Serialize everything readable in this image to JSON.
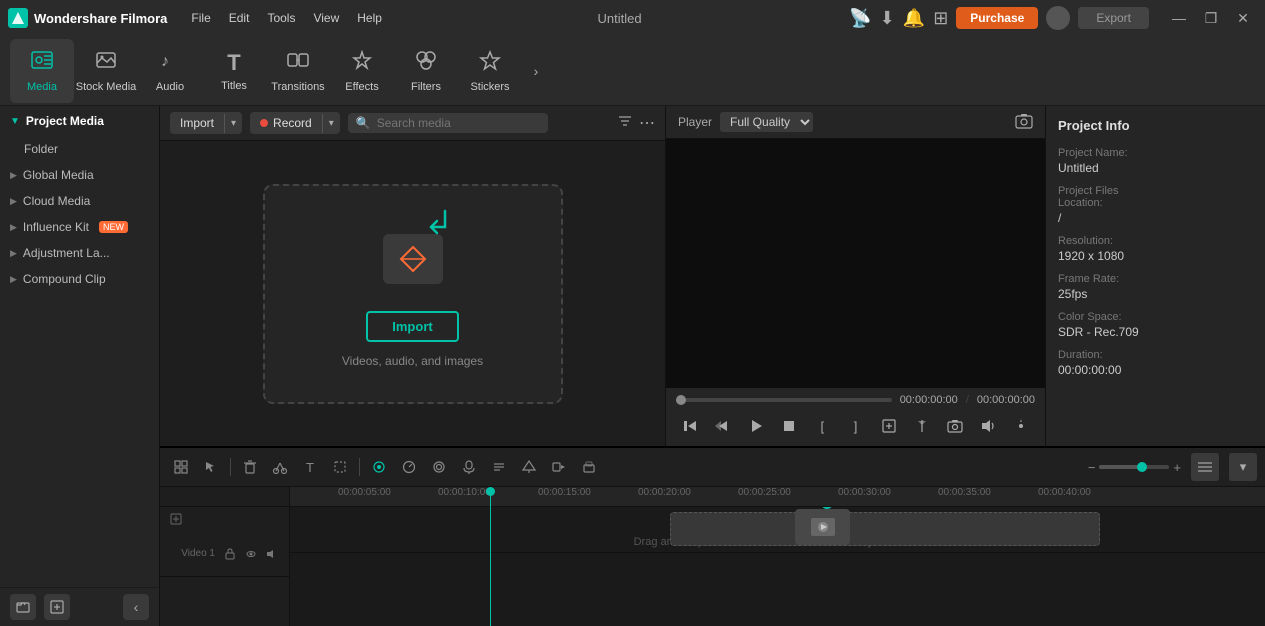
{
  "app": {
    "name": "Wondershare Filmora",
    "title": "Untitled"
  },
  "title_bar": {
    "logo_letter": "F",
    "menus": [
      "File",
      "Edit",
      "Tools",
      "View",
      "Help"
    ],
    "purchase_label": "Purchase",
    "export_label": "Export",
    "window_controls": [
      "—",
      "❐",
      "✕"
    ]
  },
  "toolbar": {
    "items": [
      {
        "id": "media",
        "icon": "🎬",
        "label": "Media",
        "active": true
      },
      {
        "id": "stock",
        "icon": "🗃",
        "label": "Stock Media",
        "active": false
      },
      {
        "id": "audio",
        "icon": "🎵",
        "label": "Audio",
        "active": false
      },
      {
        "id": "titles",
        "icon": "T",
        "label": "Titles",
        "active": false
      },
      {
        "id": "transitions",
        "icon": "⧉",
        "label": "Transitions",
        "active": false
      },
      {
        "id": "effects",
        "icon": "✨",
        "label": "Effects",
        "active": false
      },
      {
        "id": "filters",
        "icon": "🎨",
        "label": "Filters",
        "active": false
      },
      {
        "id": "stickers",
        "icon": "⭐",
        "label": "Stickers",
        "active": false
      }
    ],
    "more_icon": "›"
  },
  "left_sidebar": {
    "header": "Project Media",
    "folder_label": "Folder",
    "sections": [
      {
        "label": "Global Media"
      },
      {
        "label": "Cloud Media"
      },
      {
        "label": "Influence Kit",
        "badge": "NEW"
      },
      {
        "label": "Adjustment La..."
      },
      {
        "label": "Compound Clip"
      }
    ],
    "add_icon": "+",
    "folder_icon": "📁",
    "collapse_icon": "‹"
  },
  "media_toolbar": {
    "import_label": "Import",
    "record_label": "Record",
    "search_placeholder": "Search media",
    "filter_icon": "filter",
    "more_icon": "⋯"
  },
  "import_area": {
    "import_btn_label": "Import",
    "subtitle": "Videos, audio, and images"
  },
  "player": {
    "label": "Player",
    "quality": "Full Quality",
    "snapshot_icon": "📷",
    "time_current": "00:00:00:00",
    "time_total": "00:00:00:00",
    "controls": {
      "skip_back": "⏮",
      "step_back": "⏪",
      "play": "▶",
      "stop": "⏹",
      "mark_in": "[",
      "mark_out": "]",
      "split": "✂",
      "snapshot": "📷",
      "audio": "🔊",
      "settings": "⚙"
    }
  },
  "project_info": {
    "title": "Project Info",
    "fields": [
      {
        "label": "Project Name:",
        "value": "Untitled"
      },
      {
        "label": "Project Files\nLocation:",
        "value": "/"
      },
      {
        "label": "Resolution:",
        "value": "1920 x 1080"
      },
      {
        "label": "Frame Rate:",
        "value": "25fps"
      },
      {
        "label": "Color Space:",
        "value": "SDR - Rec.709"
      },
      {
        "label": "Duration:",
        "value": "00:00:00:00"
      }
    ]
  },
  "timeline": {
    "tools": [
      {
        "icon": "⊞",
        "label": "scene-detect",
        "active": false
      },
      {
        "icon": "↗",
        "label": "select",
        "active": false
      },
      {
        "icon": "🗑",
        "label": "delete",
        "active": false
      },
      {
        "icon": "✂",
        "label": "cut",
        "active": false
      },
      {
        "icon": "T",
        "label": "text",
        "active": false
      },
      {
        "icon": "⬜",
        "label": "crop",
        "active": false
      },
      {
        "icon": "⟳",
        "label": "loop",
        "label2": "highlighted",
        "active": true
      },
      {
        "icon": "⊙",
        "label": "speed",
        "active": false
      },
      {
        "icon": "◎",
        "label": "mask",
        "active": false
      },
      {
        "icon": "🎙",
        "label": "record",
        "active": false
      },
      {
        "icon": "≣",
        "label": "tts",
        "active": false
      },
      {
        "icon": "⊕",
        "label": "add-marker",
        "active": false
      },
      {
        "icon": "⊞",
        "label": "multicam",
        "active": false
      },
      {
        "icon": "⊡",
        "label": "composite",
        "active": false
      }
    ],
    "zoom": {
      "min_icon": "−",
      "max_icon": "+"
    },
    "ruler_marks": [
      "00:00:05:00",
      "00:00:10:00",
      "00:00:15:00",
      "00:00:20:00",
      "00:00:25:00",
      "00:00:30:00",
      "00:00:35:00",
      "00:00:40:00"
    ],
    "track_label": "Video 1",
    "drag_hint": "Drag and drop media and effects here to create your video."
  },
  "colors": {
    "accent": "#00c2a8",
    "purchase": "#e05c1a",
    "bg_dark": "#1a1a1a",
    "bg_mid": "#252525",
    "bg_light": "#2b2b2b",
    "border": "#111111",
    "text_primary": "#ffffff",
    "text_secondary": "#cccccc",
    "text_muted": "#777777"
  }
}
